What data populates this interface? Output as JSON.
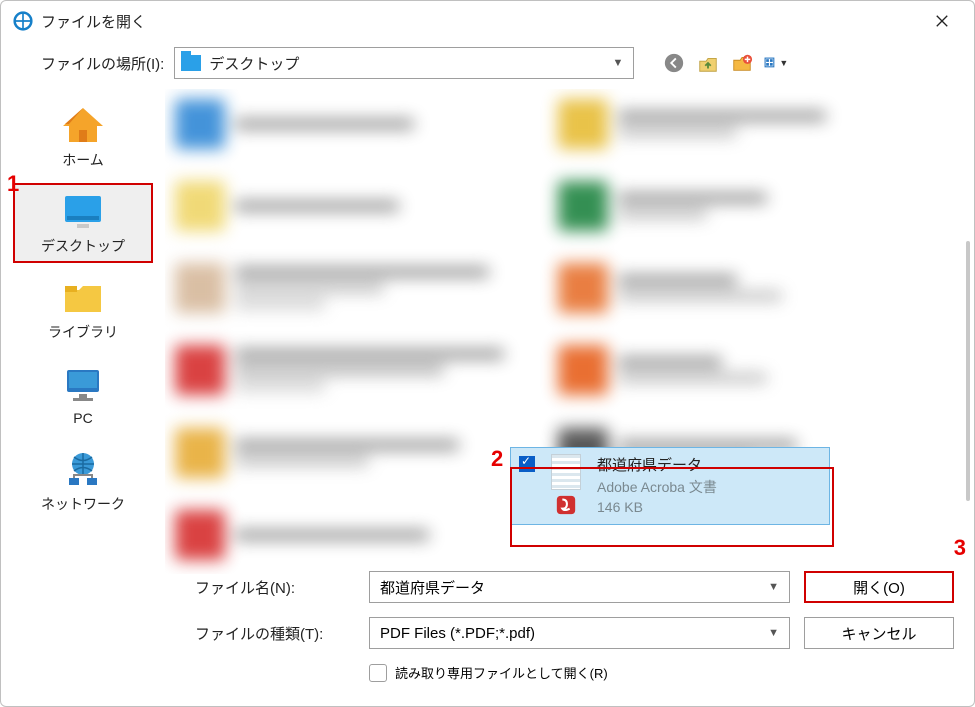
{
  "window": {
    "title": "ファイルを開く"
  },
  "location": {
    "label": "ファイルの場所(I):",
    "value": "デスクトップ"
  },
  "sidebar": {
    "items": [
      {
        "label": "ホーム"
      },
      {
        "label": "デスクトップ"
      },
      {
        "label": "ライブラリ"
      },
      {
        "label": "PC"
      },
      {
        "label": "ネットワーク"
      }
    ]
  },
  "selected_file": {
    "name": "都道府県データ",
    "type": "Adobe Acroba 文書",
    "size": "146 KB"
  },
  "form": {
    "file_name_label": "ファイル名(N):",
    "file_name_value": "都道府県データ",
    "file_type_label": "ファイルの種類(T):",
    "file_type_value": "PDF Files (*.PDF;*.pdf)",
    "readonly_label": "読み取り専用ファイルとして開く(R)",
    "open_button": "開く(O)",
    "cancel_button": "キャンセル"
  },
  "annotations": {
    "a1": "1",
    "a2": "2",
    "a3": "3"
  }
}
